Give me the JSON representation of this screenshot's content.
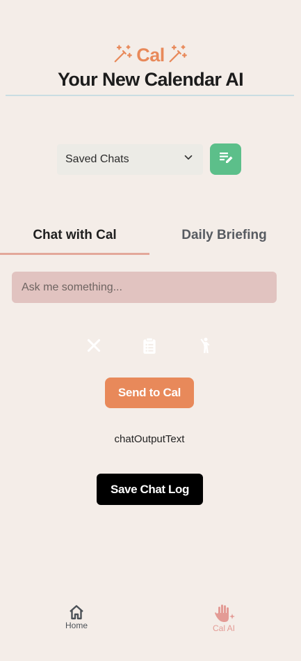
{
  "header": {
    "brand_name": "Cal",
    "subtitle": "Your New Calendar AI"
  },
  "saved_chats": {
    "selected": "Saved Chats"
  },
  "tabs": [
    {
      "label": "Chat with Cal",
      "active": true
    },
    {
      "label": "Daily Briefing",
      "active": false
    }
  ],
  "chat": {
    "input_placeholder": "Ask me something...",
    "input_value": "",
    "send_label": "Send to Cal",
    "output_text": "chatOutputText",
    "save_label": "Save Chat Log"
  },
  "quick_actions": [
    {
      "icon": "close-icon"
    },
    {
      "icon": "clipboard-list-icon"
    },
    {
      "icon": "person-waving-icon"
    }
  ],
  "bottom_nav": [
    {
      "label": "Home",
      "icon": "home-icon",
      "active": false
    },
    {
      "label": "Cal AI",
      "icon": "hand-sparkle-icon",
      "active": true
    }
  ],
  "colors": {
    "background": "#f4ede8",
    "accent": "#e8895a",
    "new_chat_button": "#5cbf8a",
    "input_background": "#e1c3c0",
    "tab_underline": "#e3a89a",
    "save_button": "#000000",
    "nav_active": "#e39b95"
  }
}
